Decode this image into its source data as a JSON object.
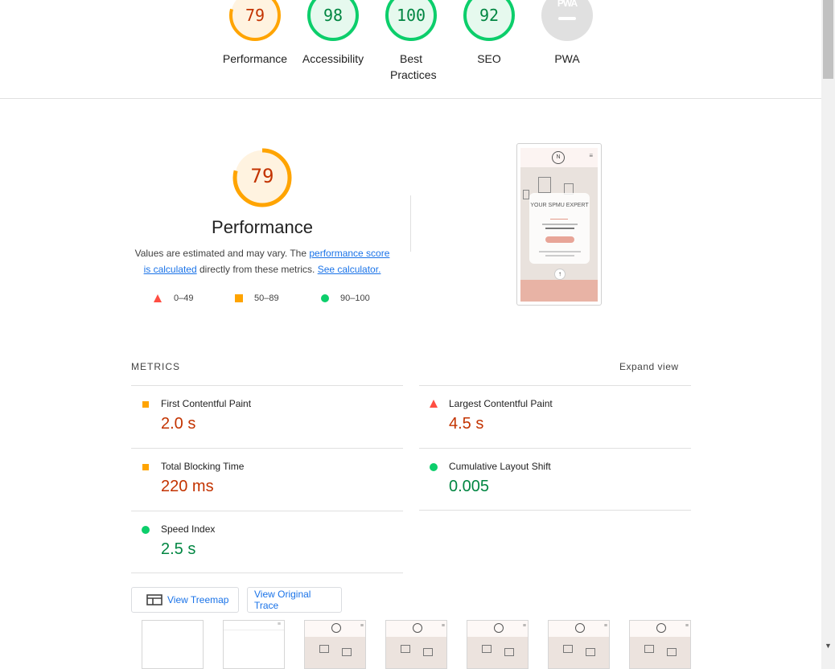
{
  "gauges": [
    {
      "score": "79",
      "label": "Performance",
      "color": "#ffa400",
      "fill": "#fff3e0",
      "text_color": "#c33300",
      "fraction": 0.79
    },
    {
      "score": "98",
      "label": "Accessibility",
      "color": "#0cce6b",
      "fill": "#e6f9ee",
      "text_color": "#018642",
      "fraction": 0.98
    },
    {
      "score": "100",
      "label": "Best Practices",
      "color": "#0cce6b",
      "fill": "#e6f9ee",
      "text_color": "#018642",
      "fraction": 1.0
    },
    {
      "score": "92",
      "label": "SEO",
      "color": "#0cce6b",
      "fill": "#e6f9ee",
      "text_color": "#018642",
      "fraction": 0.92
    },
    {
      "score": "",
      "label": "PWA",
      "badge": "PWA",
      "color": "#e0e0e0"
    }
  ],
  "performance": {
    "score": "79",
    "fraction": 0.79,
    "title": "Performance",
    "desc_prefix": "Values are estimated and may vary. The ",
    "link_score": "performance score is calculated",
    "desc_mid": " directly from these metrics. ",
    "link_calc": "See calculator.",
    "legend": {
      "fail": "0–49",
      "average": "50–89",
      "pass": "90–100"
    }
  },
  "screenshot": {
    "title_text": "YOUR SPMU EXPERT"
  },
  "metrics": {
    "heading": "METRICS",
    "expand_label": "Expand view",
    "fcp": {
      "label": "First Contentful Paint",
      "value": "2.0 s",
      "rating": "average"
    },
    "lcp": {
      "label": "Largest Contentful Paint",
      "value": "4.5 s",
      "rating": "fail"
    },
    "tbt": {
      "label": "Total Blocking Time",
      "value": "220 ms",
      "rating": "average"
    },
    "cls": {
      "label": "Cumulative Layout Shift",
      "value": "0.005",
      "rating": "pass"
    },
    "si": {
      "label": "Speed Index",
      "value": "2.5 s",
      "rating": "pass"
    }
  },
  "buttons": {
    "treemap": "View Treemap",
    "trace": "View Original Trace"
  },
  "colors": {
    "fail": "#ff4e42",
    "average": "#ffa400",
    "pass": "#0cce6b",
    "link": "#1a73e8"
  },
  "filmstrip": {
    "frame_count": 7
  }
}
